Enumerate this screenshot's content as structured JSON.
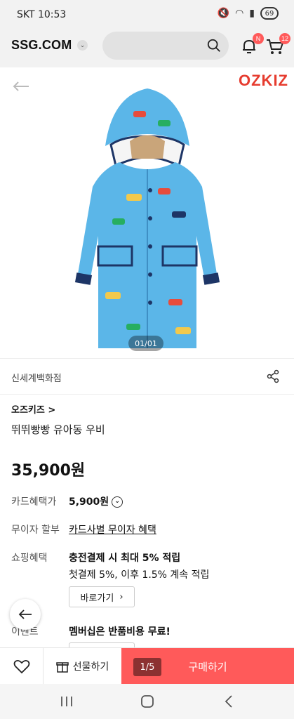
{
  "status_bar": {
    "carrier": "SKT 10:53",
    "battery": "69"
  },
  "header": {
    "logo": "SSG.COM",
    "notification_badge": "N",
    "cart_badge": "12"
  },
  "product_image": {
    "brand_logo": "OZKIZ",
    "counter": "01/01"
  },
  "store": {
    "name": "신세계백화점"
  },
  "product": {
    "brand": "오즈키즈 >",
    "title": "뛰뛰빵빵 유아동 우비",
    "price": "35,900원"
  },
  "benefits": {
    "card_label": "카드혜택가",
    "card_value": "5,900원",
    "installment_label": "무이자 할부",
    "installment_value": "카드사별 무이자 혜택",
    "shopping_label": "쇼핑혜택",
    "shopping_title": "충전결제 시 최대 5% 적립",
    "shopping_desc": "첫결제 5%, 이후 1.5% 계속 적립",
    "shortcut_button": "바로가기",
    "event_label": "이벤트",
    "event_title": "멤버십은 반품비용 무료!"
  },
  "bottom_bar": {
    "gift_label": "선물하기",
    "buy_label": "구매하기",
    "page_indicator": "1/5"
  },
  "colors": {
    "accent": "#ff5a5a",
    "coat": "#5bb6e8",
    "brand_red": "#e63c2f"
  }
}
